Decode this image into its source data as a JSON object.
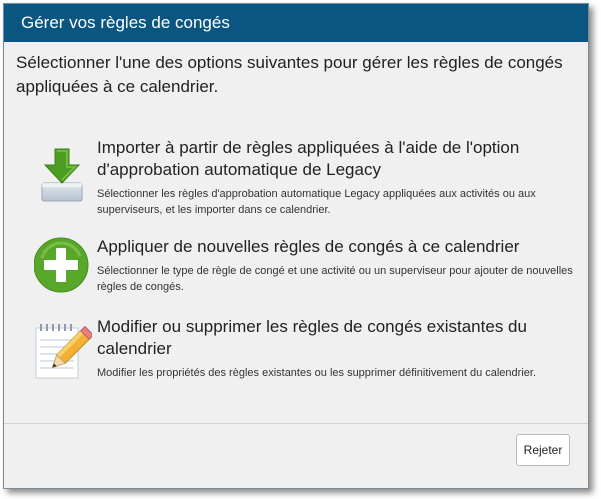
{
  "dialog": {
    "title": "Gérer vos règles de congés",
    "intro": "Sélectionner l'une des options suivantes pour gérer les règles de congés appliquées à ce calendrier."
  },
  "options": [
    {
      "icon": "download-icon",
      "title": "Importer à partir de règles appliquées à l'aide de l'option d'approbation automatique de Legacy",
      "description": "Sélectionner les règles d'approbation automatique Legacy appliquées aux activités ou aux superviseurs, et les importer dans ce calendrier."
    },
    {
      "icon": "add-icon",
      "title": "Appliquer de nouvelles règles de congés à ce calendrier",
      "description": "Sélectionner le type de règle de congé et une activité ou un superviseur pour ajouter de nouvelles règles de congés."
    },
    {
      "icon": "edit-icon",
      "title": "Modifier ou supprimer les règles de congés existantes du calendrier",
      "description": "Modifier les propriétés des règles existantes ou les supprimer définitivement du calendrier."
    }
  ],
  "footer": {
    "reject_label": "Rejeter"
  },
  "colors": {
    "titlebar": "#0b5680",
    "green": "#5aa829",
    "pencil": "#f2b134"
  }
}
